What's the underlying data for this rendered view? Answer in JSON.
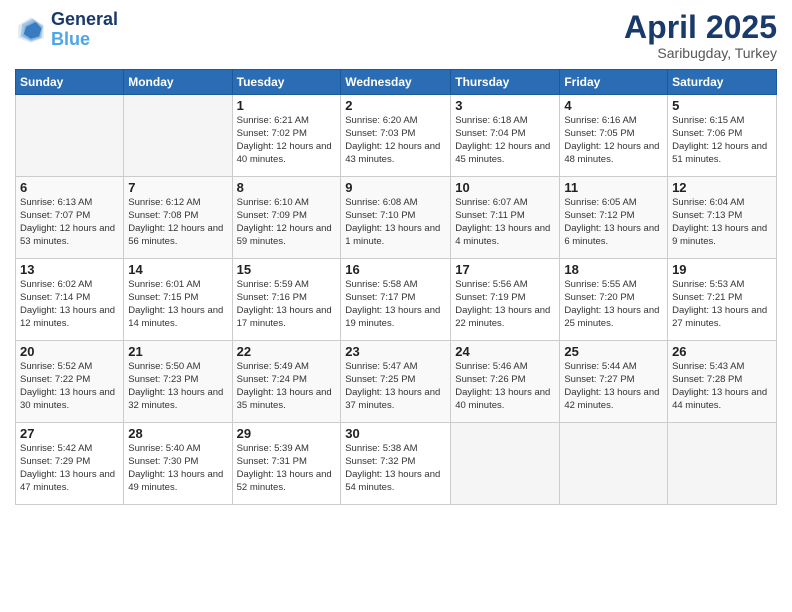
{
  "logo": {
    "line1": "General",
    "line2": "Blue"
  },
  "title": "April 2025",
  "subtitle": "Saribugday, Turkey",
  "days_of_week": [
    "Sunday",
    "Monday",
    "Tuesday",
    "Wednesday",
    "Thursday",
    "Friday",
    "Saturday"
  ],
  "weeks": [
    [
      {
        "day": "",
        "info": ""
      },
      {
        "day": "",
        "info": ""
      },
      {
        "day": "1",
        "info": "Sunrise: 6:21 AM\nSunset: 7:02 PM\nDaylight: 12 hours and 40 minutes."
      },
      {
        "day": "2",
        "info": "Sunrise: 6:20 AM\nSunset: 7:03 PM\nDaylight: 12 hours and 43 minutes."
      },
      {
        "day": "3",
        "info": "Sunrise: 6:18 AM\nSunset: 7:04 PM\nDaylight: 12 hours and 45 minutes."
      },
      {
        "day": "4",
        "info": "Sunrise: 6:16 AM\nSunset: 7:05 PM\nDaylight: 12 hours and 48 minutes."
      },
      {
        "day": "5",
        "info": "Sunrise: 6:15 AM\nSunset: 7:06 PM\nDaylight: 12 hours and 51 minutes."
      }
    ],
    [
      {
        "day": "6",
        "info": "Sunrise: 6:13 AM\nSunset: 7:07 PM\nDaylight: 12 hours and 53 minutes."
      },
      {
        "day": "7",
        "info": "Sunrise: 6:12 AM\nSunset: 7:08 PM\nDaylight: 12 hours and 56 minutes."
      },
      {
        "day": "8",
        "info": "Sunrise: 6:10 AM\nSunset: 7:09 PM\nDaylight: 12 hours and 59 minutes."
      },
      {
        "day": "9",
        "info": "Sunrise: 6:08 AM\nSunset: 7:10 PM\nDaylight: 13 hours and 1 minute."
      },
      {
        "day": "10",
        "info": "Sunrise: 6:07 AM\nSunset: 7:11 PM\nDaylight: 13 hours and 4 minutes."
      },
      {
        "day": "11",
        "info": "Sunrise: 6:05 AM\nSunset: 7:12 PM\nDaylight: 13 hours and 6 minutes."
      },
      {
        "day": "12",
        "info": "Sunrise: 6:04 AM\nSunset: 7:13 PM\nDaylight: 13 hours and 9 minutes."
      }
    ],
    [
      {
        "day": "13",
        "info": "Sunrise: 6:02 AM\nSunset: 7:14 PM\nDaylight: 13 hours and 12 minutes."
      },
      {
        "day": "14",
        "info": "Sunrise: 6:01 AM\nSunset: 7:15 PM\nDaylight: 13 hours and 14 minutes."
      },
      {
        "day": "15",
        "info": "Sunrise: 5:59 AM\nSunset: 7:16 PM\nDaylight: 13 hours and 17 minutes."
      },
      {
        "day": "16",
        "info": "Sunrise: 5:58 AM\nSunset: 7:17 PM\nDaylight: 13 hours and 19 minutes."
      },
      {
        "day": "17",
        "info": "Sunrise: 5:56 AM\nSunset: 7:19 PM\nDaylight: 13 hours and 22 minutes."
      },
      {
        "day": "18",
        "info": "Sunrise: 5:55 AM\nSunset: 7:20 PM\nDaylight: 13 hours and 25 minutes."
      },
      {
        "day": "19",
        "info": "Sunrise: 5:53 AM\nSunset: 7:21 PM\nDaylight: 13 hours and 27 minutes."
      }
    ],
    [
      {
        "day": "20",
        "info": "Sunrise: 5:52 AM\nSunset: 7:22 PM\nDaylight: 13 hours and 30 minutes."
      },
      {
        "day": "21",
        "info": "Sunrise: 5:50 AM\nSunset: 7:23 PM\nDaylight: 13 hours and 32 minutes."
      },
      {
        "day": "22",
        "info": "Sunrise: 5:49 AM\nSunset: 7:24 PM\nDaylight: 13 hours and 35 minutes."
      },
      {
        "day": "23",
        "info": "Sunrise: 5:47 AM\nSunset: 7:25 PM\nDaylight: 13 hours and 37 minutes."
      },
      {
        "day": "24",
        "info": "Sunrise: 5:46 AM\nSunset: 7:26 PM\nDaylight: 13 hours and 40 minutes."
      },
      {
        "day": "25",
        "info": "Sunrise: 5:44 AM\nSunset: 7:27 PM\nDaylight: 13 hours and 42 minutes."
      },
      {
        "day": "26",
        "info": "Sunrise: 5:43 AM\nSunset: 7:28 PM\nDaylight: 13 hours and 44 minutes."
      }
    ],
    [
      {
        "day": "27",
        "info": "Sunrise: 5:42 AM\nSunset: 7:29 PM\nDaylight: 13 hours and 47 minutes."
      },
      {
        "day": "28",
        "info": "Sunrise: 5:40 AM\nSunset: 7:30 PM\nDaylight: 13 hours and 49 minutes."
      },
      {
        "day": "29",
        "info": "Sunrise: 5:39 AM\nSunset: 7:31 PM\nDaylight: 13 hours and 52 minutes."
      },
      {
        "day": "30",
        "info": "Sunrise: 5:38 AM\nSunset: 7:32 PM\nDaylight: 13 hours and 54 minutes."
      },
      {
        "day": "",
        "info": ""
      },
      {
        "day": "",
        "info": ""
      },
      {
        "day": "",
        "info": ""
      }
    ]
  ]
}
